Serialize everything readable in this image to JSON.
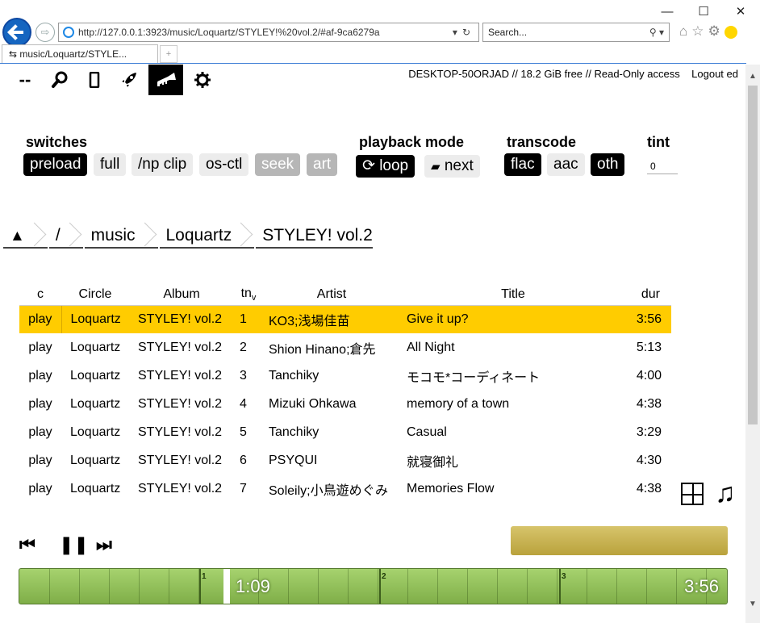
{
  "browser": {
    "url": "http://127.0.0.1:3923/music/Loquartz/STYLEY!%20vol.2/#af-9ca6279a",
    "search_placeholder": "Search...",
    "tab_title": "music/Loquartz/STYLE...",
    "window_controls": [
      "—",
      "☐",
      "✕"
    ]
  },
  "topbar": {
    "ops": [
      {
        "label": "--",
        "icon": "dashes-icon"
      },
      {
        "icon": "search-icon"
      },
      {
        "icon": "phone-icon"
      },
      {
        "icon": "rocket-icon"
      },
      {
        "icon": "trumpet-icon",
        "active": true
      },
      {
        "icon": "gear-icon"
      }
    ],
    "status": "DESKTOP-50ORJAD // 18.2 GiB free  //  Read-Only access",
    "logout": "Logout ed"
  },
  "controls": {
    "switches_title": "switches",
    "switches": [
      "preload",
      "full",
      "/np clip",
      "os-ctl",
      "seek",
      "art"
    ],
    "playback_title": "playback mode",
    "loop": "loop",
    "next": "next",
    "transcode_title": "transcode",
    "transcode": [
      "flac",
      "aac",
      "oth"
    ],
    "tint_title": "tint",
    "tint_value": "0"
  },
  "breadcrumb": {
    "root_icon": "tree-icon",
    "items": [
      "/",
      "music",
      "Loquartz",
      "STYLEY! vol.2"
    ]
  },
  "table": {
    "headers": {
      "c": "c",
      "circle": "Circle",
      "album": "Album",
      "tn": "tn",
      "tn_sub": "v",
      "artist": "Artist",
      "title": "Title",
      "dur": "dur"
    },
    "rows": [
      {
        "play": "play",
        "circle": "Loquartz",
        "album": "STYLEY! vol.2",
        "tn": "1",
        "artist": "KO3;浅場佳苗",
        "title": "Give it up?",
        "dur": "3:56"
      },
      {
        "play": "play",
        "circle": "Loquartz",
        "album": "STYLEY! vol.2",
        "tn": "2",
        "artist": "Shion Hinano;倉先",
        "title": "All Night",
        "dur": "5:13"
      },
      {
        "play": "play",
        "circle": "Loquartz",
        "album": "STYLEY! vol.2",
        "tn": "3",
        "artist": "Tanchiky",
        "title": "モコモ*コーディネート",
        "dur": "4:00"
      },
      {
        "play": "play",
        "circle": "Loquartz",
        "album": "STYLEY! vol.2",
        "tn": "4",
        "artist": "Mizuki Ohkawa",
        "title": "memory of a town",
        "dur": "4:38"
      },
      {
        "play": "play",
        "circle": "Loquartz",
        "album": "STYLEY! vol.2",
        "tn": "5",
        "artist": "Tanchiky",
        "title": "Casual",
        "dur": "3:29"
      },
      {
        "play": "play",
        "circle": "Loquartz",
        "album": "STYLEY! vol.2",
        "tn": "6",
        "artist": "PSYQUI",
        "title": "就寝御礼",
        "dur": "4:30"
      },
      {
        "play": "play",
        "circle": "Loquartz",
        "album": "STYLEY! vol.2",
        "tn": "7",
        "artist": "Soleily;小鳥遊めぐみ",
        "title": "Memories Flow",
        "dur": "4:38"
      }
    ]
  },
  "player": {
    "prev_icon": "prev-icon",
    "pause_icon": "pause-icon",
    "next_icon": "next-icon",
    "position": "1:09",
    "duration": "3:56",
    "markers": [
      "1",
      "2",
      "3"
    ],
    "colors": {
      "seek": "#8fbf56",
      "volume": "#c8b24f",
      "playing_row": "#ffcc00"
    }
  }
}
